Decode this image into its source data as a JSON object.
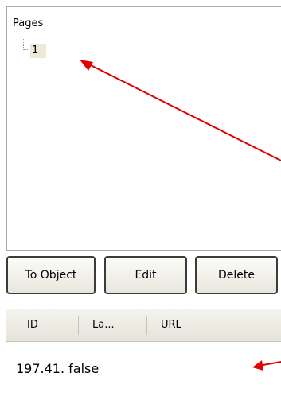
{
  "tree": {
    "root_label": "Pages",
    "nodes": [
      {
        "label": "1"
      }
    ]
  },
  "buttons": {
    "to_object": "To Object",
    "edit": "Edit",
    "delete": "Delete"
  },
  "list": {
    "columns": [
      "ID",
      "La...",
      "URL"
    ],
    "rows": [
      {
        "text": "197.41.  false"
      }
    ]
  },
  "colors": {
    "annotation_arrow": "#e00000",
    "selected_node_bg": "#ece9d8"
  }
}
